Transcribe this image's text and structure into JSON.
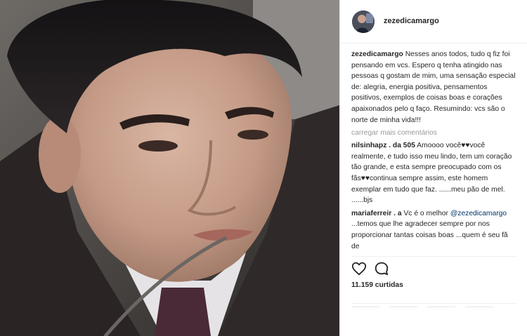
{
  "post": {
    "username": "zezedicamargo",
    "caption_user": "zezedicamargo",
    "caption_text": "Nesses anos todos, tudo q fiz foi pensando em vcs. Espero q tenha atingido nas pessoas q gostam de mim, uma sensação especial de: alegria, energia positiva, pensamentos positivos, exemplos de coisas boas e corações apaixonados pelo q faço. Resumindo: vcs são o norte de minha vida!!!",
    "load_more": "carregar mais comentários",
    "likes": "11.159 curtidas"
  },
  "comments": [
    {
      "user": "nilsinhapz . da 505",
      "text": "Amoooo você♥♥você realmente, e tudo isso meu lindo, tem um coração tão grande, e esta sempre preocupado com os fãs♥♥continua sempre assim, este homem exemplar em tudo que faz. ......meu pão de mel. ......bjs"
    },
    {
      "user": "mariaferreir . a",
      "text": "Vc é o melhor",
      "mention": "@zezedicamargo",
      "text2": "...temos que lhe agradecer sempre por nos proporcionar tantas coisas boas ...quem é seu fã de"
    }
  ],
  "icons": {
    "like": "heart-outline-icon",
    "comment": "speech-bubble-icon"
  },
  "colors": {
    "text": "#262626",
    "muted": "#999999",
    "mention": "#003569",
    "border": "#efefef"
  }
}
